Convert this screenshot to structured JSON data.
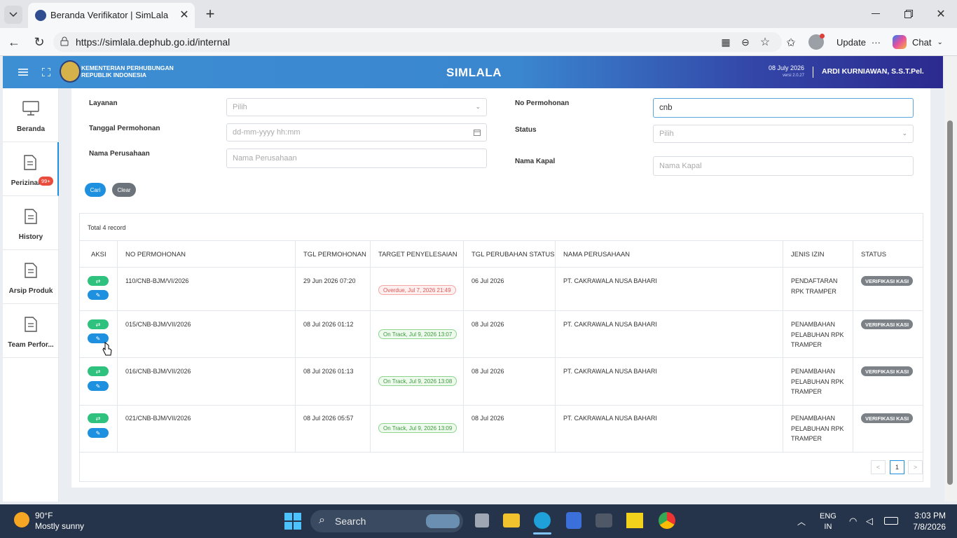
{
  "browser": {
    "tab_title": "Beranda Verifikator | SimLala",
    "url": "https://simlala.dephub.go.id/internal",
    "update_label": "Update",
    "chat_label": "Chat"
  },
  "header": {
    "org_line1": "KEMENTERIAN PERHUBUNGAN",
    "org_line2": "REPUBLIK INDONESIA",
    "app_title": "SIMLALA",
    "date": "08 July 2026",
    "version": "versi 2.0.27",
    "user": "ARDI KURNIAWAN, S.S.T.Pel."
  },
  "sidebar": {
    "items": [
      {
        "label": "Beranda"
      },
      {
        "label": "Perizinan",
        "badge": "99+"
      },
      {
        "label": "History"
      },
      {
        "label": "Arsip Produk"
      },
      {
        "label": "Team Perfor..."
      }
    ]
  },
  "filters": {
    "layanan_label": "Layanan",
    "layanan_value": "Pilih",
    "tanggal_label": "Tanggal Permohonan",
    "tanggal_placeholder": "dd-mm-yyyy hh:mm",
    "perusahaan_label": "Nama Perusahaan",
    "perusahaan_placeholder": "Nama Perusahaan",
    "no_label": "No Permohonan",
    "no_value": "cnb",
    "status_label": "Status",
    "status_value": "Pilih",
    "kapal_label": "Nama Kapal",
    "kapal_placeholder": "Nama Kapal",
    "cari_label": "Cari",
    "clear_label": "Clear"
  },
  "table": {
    "total": "Total 4 record",
    "headers": [
      "AKSI",
      "NO PERMOHONAN",
      "TGL PERMOHONAN",
      "TARGET PENYELESAIAN",
      "TGL PERUBAHAN STATUS",
      "NAMA PERUSAHAAN",
      "JENIS IZIN",
      "STATUS"
    ],
    "rows": [
      {
        "no": "110/CNB-BJM/VI/2026",
        "tgl": "29 Jun 2026 07:20",
        "target": "Overdue, Jul 7, 2026 21:49",
        "target_state": "overdue",
        "ubah": "06 Jul 2026",
        "perusahaan": "PT. CAKRAWALA NUSA BAHARI",
        "jenis": [
          "PENDAFTARAN",
          "RPK TRAMPER"
        ],
        "status": "VERIFIKASI KASI"
      },
      {
        "no": "015/CNB-BJM/VII/2026",
        "tgl": "08 Jul 2026 01:12",
        "target": "On Track, Jul 9, 2026 13:07",
        "target_state": "ontrack",
        "ubah": "08 Jul 2026",
        "perusahaan": "PT. CAKRAWALA NUSA BAHARI",
        "jenis": [
          "PENAMBAHAN",
          "PELABUHAN RPK",
          "TRAMPER"
        ],
        "status": "VERIFIKASI KASI"
      },
      {
        "no": "016/CNB-BJM/VII/2026",
        "tgl": "08 Jul 2026 01:13",
        "target": "On Track, Jul 9, 2026 13:08",
        "target_state": "ontrack",
        "ubah": "08 Jul 2026",
        "perusahaan": "PT. CAKRAWALA NUSA BAHARI",
        "jenis": [
          "PENAMBAHAN",
          "PELABUHAN RPK",
          "TRAMPER"
        ],
        "status": "VERIFIKASI KASI"
      },
      {
        "no": "021/CNB-BJM/VII/2026",
        "tgl": "08 Jul 2026 05:57",
        "target": "On Track, Jul 9, 2026 13:09",
        "target_state": "ontrack",
        "ubah": "08 Jul 2026",
        "perusahaan": "PT. CAKRAWALA NUSA BAHARI",
        "jenis": [
          "PENAMBAHAN",
          "PELABUHAN RPK",
          "TRAMPER"
        ],
        "status": "VERIFIKASI KASI"
      }
    ],
    "page": "1",
    "prev": "<",
    "next": ">"
  },
  "taskbar": {
    "temp": "90°F",
    "weather": "Mostly sunny",
    "search": "Search",
    "lang1": "ENG",
    "lang2": "IN",
    "time": "3:03 PM",
    "date": "7/8/2026"
  },
  "colors": {
    "accent_blue": "#1e90e0",
    "action_green": "#2ec27e",
    "badge_red": "#e74c3c",
    "status_gray": "#7c8187"
  }
}
